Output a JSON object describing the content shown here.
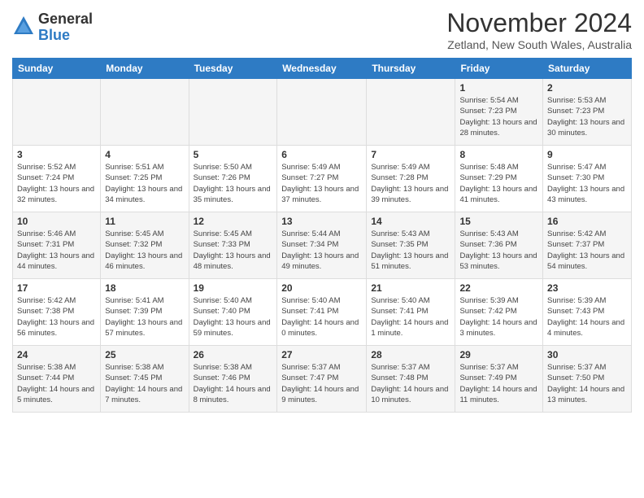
{
  "header": {
    "logo": {
      "general": "General",
      "blue": "Blue"
    },
    "title": "November 2024",
    "subtitle": "Zetland, New South Wales, Australia"
  },
  "calendar": {
    "weekdays": [
      "Sunday",
      "Monday",
      "Tuesday",
      "Wednesday",
      "Thursday",
      "Friday",
      "Saturday"
    ],
    "weeks": [
      [
        {
          "day": "",
          "info": ""
        },
        {
          "day": "",
          "info": ""
        },
        {
          "day": "",
          "info": ""
        },
        {
          "day": "",
          "info": ""
        },
        {
          "day": "",
          "info": ""
        },
        {
          "day": "1",
          "info": "Sunrise: 5:54 AM\nSunset: 7:23 PM\nDaylight: 13 hours\nand 28 minutes."
        },
        {
          "day": "2",
          "info": "Sunrise: 5:53 AM\nSunset: 7:23 PM\nDaylight: 13 hours\nand 30 minutes."
        }
      ],
      [
        {
          "day": "3",
          "info": "Sunrise: 5:52 AM\nSunset: 7:24 PM\nDaylight: 13 hours\nand 32 minutes."
        },
        {
          "day": "4",
          "info": "Sunrise: 5:51 AM\nSunset: 7:25 PM\nDaylight: 13 hours\nand 34 minutes."
        },
        {
          "day": "5",
          "info": "Sunrise: 5:50 AM\nSunset: 7:26 PM\nDaylight: 13 hours\nand 35 minutes."
        },
        {
          "day": "6",
          "info": "Sunrise: 5:49 AM\nSunset: 7:27 PM\nDaylight: 13 hours\nand 37 minutes."
        },
        {
          "day": "7",
          "info": "Sunrise: 5:49 AM\nSunset: 7:28 PM\nDaylight: 13 hours\nand 39 minutes."
        },
        {
          "day": "8",
          "info": "Sunrise: 5:48 AM\nSunset: 7:29 PM\nDaylight: 13 hours\nand 41 minutes."
        },
        {
          "day": "9",
          "info": "Sunrise: 5:47 AM\nSunset: 7:30 PM\nDaylight: 13 hours\nand 43 minutes."
        }
      ],
      [
        {
          "day": "10",
          "info": "Sunrise: 5:46 AM\nSunset: 7:31 PM\nDaylight: 13 hours\nand 44 minutes."
        },
        {
          "day": "11",
          "info": "Sunrise: 5:45 AM\nSunset: 7:32 PM\nDaylight: 13 hours\nand 46 minutes."
        },
        {
          "day": "12",
          "info": "Sunrise: 5:45 AM\nSunset: 7:33 PM\nDaylight: 13 hours\nand 48 minutes."
        },
        {
          "day": "13",
          "info": "Sunrise: 5:44 AM\nSunset: 7:34 PM\nDaylight: 13 hours\nand 49 minutes."
        },
        {
          "day": "14",
          "info": "Sunrise: 5:43 AM\nSunset: 7:35 PM\nDaylight: 13 hours\nand 51 minutes."
        },
        {
          "day": "15",
          "info": "Sunrise: 5:43 AM\nSunset: 7:36 PM\nDaylight: 13 hours\nand 53 minutes."
        },
        {
          "day": "16",
          "info": "Sunrise: 5:42 AM\nSunset: 7:37 PM\nDaylight: 13 hours\nand 54 minutes."
        }
      ],
      [
        {
          "day": "17",
          "info": "Sunrise: 5:42 AM\nSunset: 7:38 PM\nDaylight: 13 hours\nand 56 minutes."
        },
        {
          "day": "18",
          "info": "Sunrise: 5:41 AM\nSunset: 7:39 PM\nDaylight: 13 hours\nand 57 minutes."
        },
        {
          "day": "19",
          "info": "Sunrise: 5:40 AM\nSunset: 7:40 PM\nDaylight: 13 hours\nand 59 minutes."
        },
        {
          "day": "20",
          "info": "Sunrise: 5:40 AM\nSunset: 7:41 PM\nDaylight: 14 hours\nand 0 minutes."
        },
        {
          "day": "21",
          "info": "Sunrise: 5:40 AM\nSunset: 7:41 PM\nDaylight: 14 hours\nand 1 minute."
        },
        {
          "day": "22",
          "info": "Sunrise: 5:39 AM\nSunset: 7:42 PM\nDaylight: 14 hours\nand 3 minutes."
        },
        {
          "day": "23",
          "info": "Sunrise: 5:39 AM\nSunset: 7:43 PM\nDaylight: 14 hours\nand 4 minutes."
        }
      ],
      [
        {
          "day": "24",
          "info": "Sunrise: 5:38 AM\nSunset: 7:44 PM\nDaylight: 14 hours\nand 5 minutes."
        },
        {
          "day": "25",
          "info": "Sunrise: 5:38 AM\nSunset: 7:45 PM\nDaylight: 14 hours\nand 7 minutes."
        },
        {
          "day": "26",
          "info": "Sunrise: 5:38 AM\nSunset: 7:46 PM\nDaylight: 14 hours\nand 8 minutes."
        },
        {
          "day": "27",
          "info": "Sunrise: 5:37 AM\nSunset: 7:47 PM\nDaylight: 14 hours\nand 9 minutes."
        },
        {
          "day": "28",
          "info": "Sunrise: 5:37 AM\nSunset: 7:48 PM\nDaylight: 14 hours\nand 10 minutes."
        },
        {
          "day": "29",
          "info": "Sunrise: 5:37 AM\nSunset: 7:49 PM\nDaylight: 14 hours\nand 11 minutes."
        },
        {
          "day": "30",
          "info": "Sunrise: 5:37 AM\nSunset: 7:50 PM\nDaylight: 14 hours\nand 13 minutes."
        }
      ]
    ]
  }
}
